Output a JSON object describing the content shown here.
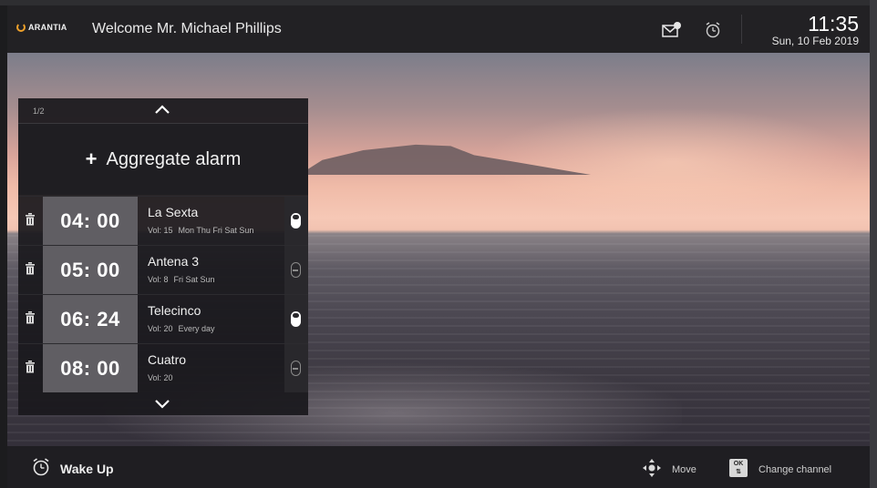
{
  "header": {
    "brand": "ARANTIA",
    "welcome": "Welcome Mr. Michael Phillips",
    "time": "11:35",
    "date": "Sun, 10 Feb 2019"
  },
  "alarm_panel": {
    "page_indicator": "1/2",
    "add_label": "Aggregate alarm",
    "alarms": [
      {
        "time": "04: 00",
        "channel": "La Sexta",
        "vol": "Vol: 15",
        "days": "Mon Thu Fri Sat Sun",
        "enabled": true
      },
      {
        "time": "05: 00",
        "channel": "Antena 3",
        "vol": "Vol: 8",
        "days": "Fri Sat Sun",
        "enabled": false
      },
      {
        "time": "06: 24",
        "channel": "Telecinco",
        "vol": "Vol: 20",
        "days": "Every day",
        "enabled": true
      },
      {
        "time": "08: 00",
        "channel": "Cuatro",
        "vol": "Vol: 20",
        "days": "",
        "enabled": false
      }
    ]
  },
  "footer": {
    "title": "Wake Up",
    "move_label": "Move",
    "ok_key": "OK",
    "change_label": "Change channel"
  },
  "colors": {
    "brand_accent": "#f0a12a",
    "time_box": "#605e63",
    "panel_bg": "#1a191d"
  }
}
